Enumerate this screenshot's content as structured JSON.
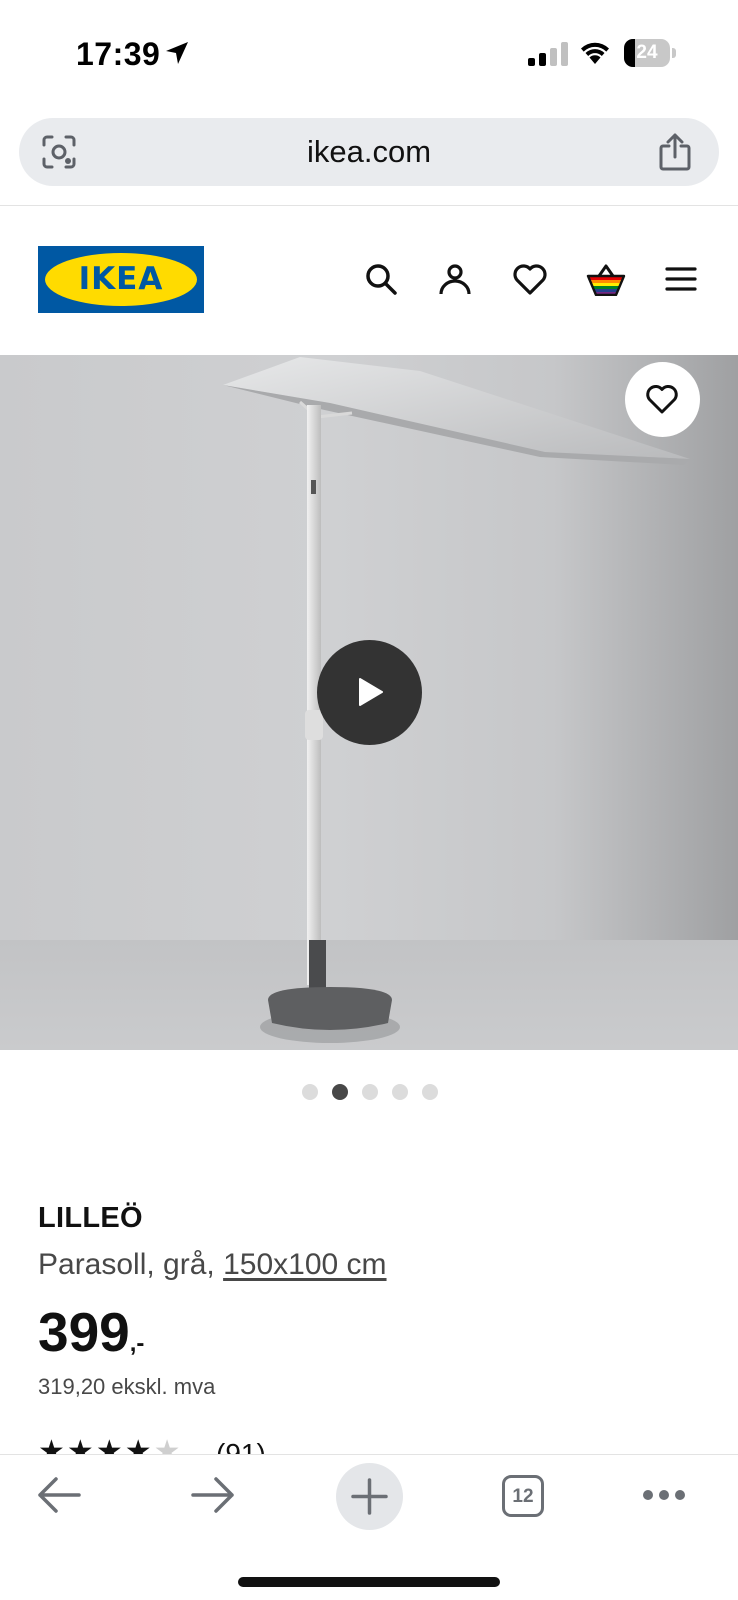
{
  "status_bar": {
    "time": "17:39",
    "battery_level": "24",
    "battery_fraction": 0.24,
    "icons": [
      "location-arrow-icon",
      "cellular-signal-icon",
      "wifi-icon",
      "battery-icon"
    ]
  },
  "browser": {
    "url": "ikea.com",
    "left_icon": "visual-search-icon",
    "right_icon": "share-icon"
  },
  "header": {
    "logo_text": "IKEA",
    "icons": [
      "search-icon",
      "account-icon",
      "favourites-icon",
      "cart-icon",
      "menu-icon"
    ],
    "colors": {
      "logo_blue": "#0058a3",
      "logo_yellow": "#ffdb00"
    }
  },
  "media": {
    "favourite_icon": "heart-icon",
    "play_icon": "play-icon",
    "slide_count": 5,
    "active_slide": 2
  },
  "product": {
    "name": "LILLEÖ",
    "description": "Parasoll, grå,",
    "size": "150x100 cm",
    "price": "399",
    "price_suffix": ",-",
    "price_ex_vat": "319,20 ekskl. mva",
    "rating_stars": 4,
    "rating_count": "(91)"
  },
  "toolbar": {
    "tabs_count": "12",
    "icons": [
      "back-arrow-icon",
      "forward-arrow-icon",
      "new-tab-plus-icon",
      "tabs-icon",
      "more-icon"
    ]
  }
}
